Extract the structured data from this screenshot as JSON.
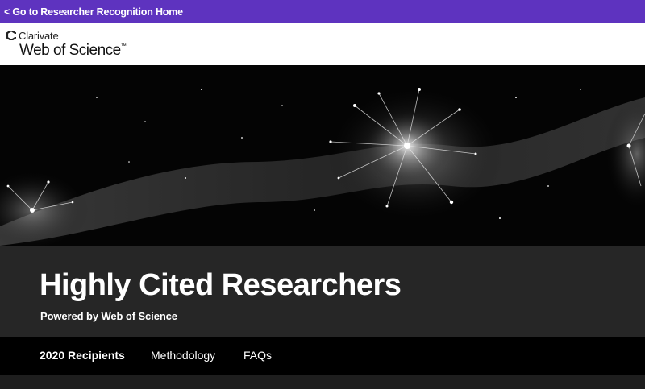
{
  "topbar": {
    "back_link": "< Go to Researcher Recognition Home",
    "color": "#5e33bf"
  },
  "brand": {
    "company": "Clarivate",
    "product": "Web of Science",
    "trademark": "™",
    "logo_icon": "clarivate-logo-icon"
  },
  "hero": {
    "image": "dark particle network / neuron illustration"
  },
  "page": {
    "title": "Highly Cited Researchers",
    "subtitle": "Powered by Web of Science"
  },
  "tabs": [
    {
      "label": "2020 Recipients",
      "active": true
    },
    {
      "label": "Methodology",
      "active": false
    },
    {
      "label": "FAQs",
      "active": false
    }
  ]
}
